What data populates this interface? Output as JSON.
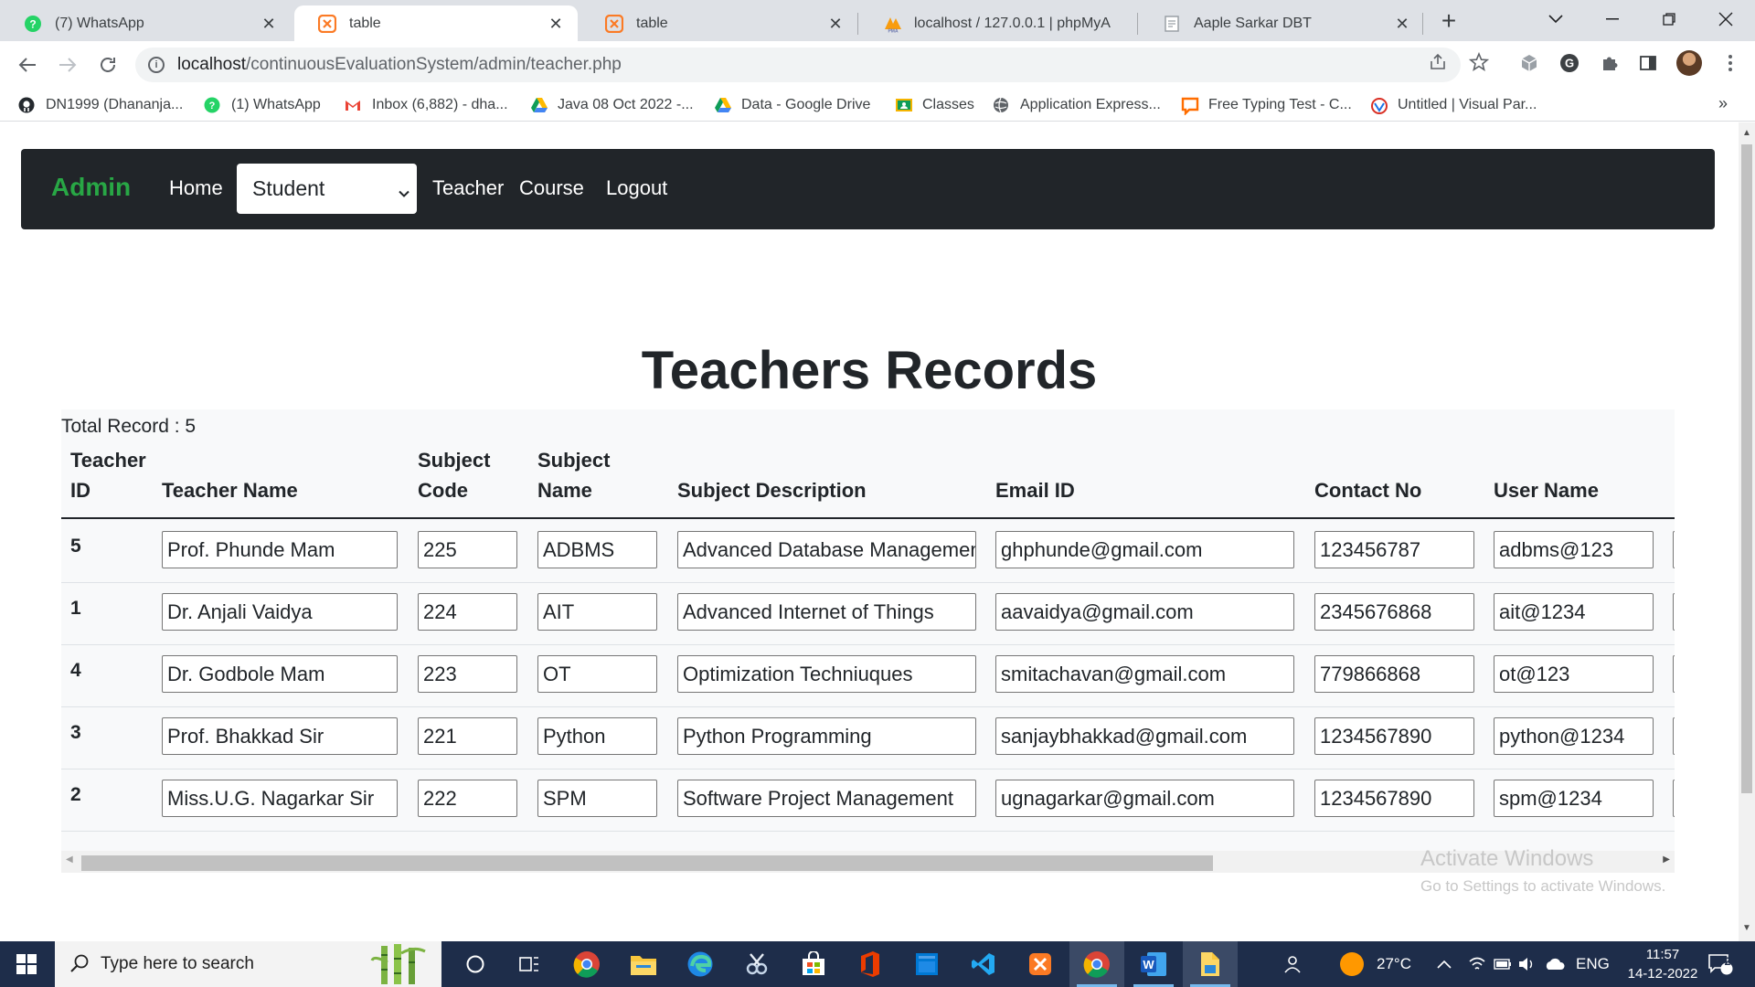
{
  "browser": {
    "tabs": [
      {
        "title": "(7) WhatsApp",
        "icon": "whatsapp-icon",
        "active": false
      },
      {
        "title": "table",
        "icon": "xampp-icon",
        "active": true
      },
      {
        "title": "table",
        "icon": "xampp-icon",
        "active": false
      },
      {
        "title": "localhost / 127.0.0.1 | phpMyA",
        "icon": "phpmyadmin-icon",
        "active": false
      },
      {
        "title": "Aaple Sarkar DBT",
        "icon": "document-icon",
        "active": false
      }
    ],
    "url_host": "localhost",
    "url_path": "/continuousEvaluationSystem/admin/teacher.php",
    "bookmarks": [
      {
        "label": "DN1999 (Dhananja...",
        "icon": "github-icon"
      },
      {
        "label": "(1) WhatsApp",
        "icon": "whatsapp-icon"
      },
      {
        "label": "Inbox (6,882) - dha...",
        "icon": "gmail-icon"
      },
      {
        "label": "Java 08 Oct 2022 -...",
        "icon": "google-drive-icon"
      },
      {
        "label": "Data - Google Drive",
        "icon": "google-drive-icon"
      },
      {
        "label": "Classes",
        "icon": "classroom-icon"
      },
      {
        "label": "Application Express...",
        "icon": "globe-icon"
      },
      {
        "label": "Free Typing Test - C...",
        "icon": "typing-icon"
      },
      {
        "label": "Untitled | Visual Par...",
        "icon": "visual-paradigm-icon"
      }
    ],
    "more_bookmarks": "»"
  },
  "navbar": {
    "brand": "Admin",
    "home": "Home",
    "select_value": "Student",
    "teacher": "Teacher",
    "course": "Course",
    "logout": "Logout"
  },
  "page": {
    "title": "Teachers Records",
    "total_record": "Total Record : 5"
  },
  "table": {
    "headers": {
      "teacher_id_1": "Teacher",
      "teacher_id_2": "ID",
      "teacher_name": "Teacher Name",
      "subject_code_1": "Subject",
      "subject_code_2": "Code",
      "subject_name_1": "Subject",
      "subject_name_2": "Name",
      "subject_description": "Subject Description",
      "email_id": "Email ID",
      "contact_no": "Contact No",
      "user_name": "User Name"
    },
    "rows": [
      {
        "id": "5",
        "name": "Prof. Phunde Mam",
        "code": "225",
        "subject": "ADBMS",
        "description": "Advanced Database Managemen",
        "email": "ghphunde@gmail.com",
        "contact": "123456787",
        "username": "adbms@123"
      },
      {
        "id": "1",
        "name": "Dr. Anjali Vaidya",
        "code": "224",
        "subject": "AIT",
        "description": "Advanced Internet of Things",
        "email": "aavaidya@gmail.com",
        "contact": "2345676868",
        "username": "ait@1234"
      },
      {
        "id": "4",
        "name": "Dr. Godbole Mam",
        "code": "223",
        "subject": "OT",
        "description": "Optimization Techniuques",
        "email": "smitachavan@gmail.com",
        "contact": "779866868",
        "username": "ot@123"
      },
      {
        "id": "3",
        "name": "Prof. Bhakkad Sir",
        "code": "221",
        "subject": "Python",
        "description": "Python Programming",
        "email": "sanjaybhakkad@gmail.com",
        "contact": "1234567890",
        "username": "python@1234"
      },
      {
        "id": "2",
        "name": "Miss.U.G. Nagarkar Sir",
        "code": "222",
        "subject": "SPM",
        "description": "Software Project Management",
        "email": "ugnagarkar@gmail.com",
        "contact": "1234567890",
        "username": "spm@1234"
      }
    ]
  },
  "watermark": {
    "line1": "Activate Windows",
    "line2": "Go to Settings to activate Windows."
  },
  "taskbar": {
    "search_placeholder": "Type here to search",
    "weather": "27°C",
    "language": "ENG",
    "time": "11:57",
    "date": "14-12-2022",
    "notification_count": "2"
  },
  "colors": {
    "brand_green": "#28a745",
    "navbar_bg": "#212529",
    "taskbar_bg": "#1e2d4a"
  }
}
